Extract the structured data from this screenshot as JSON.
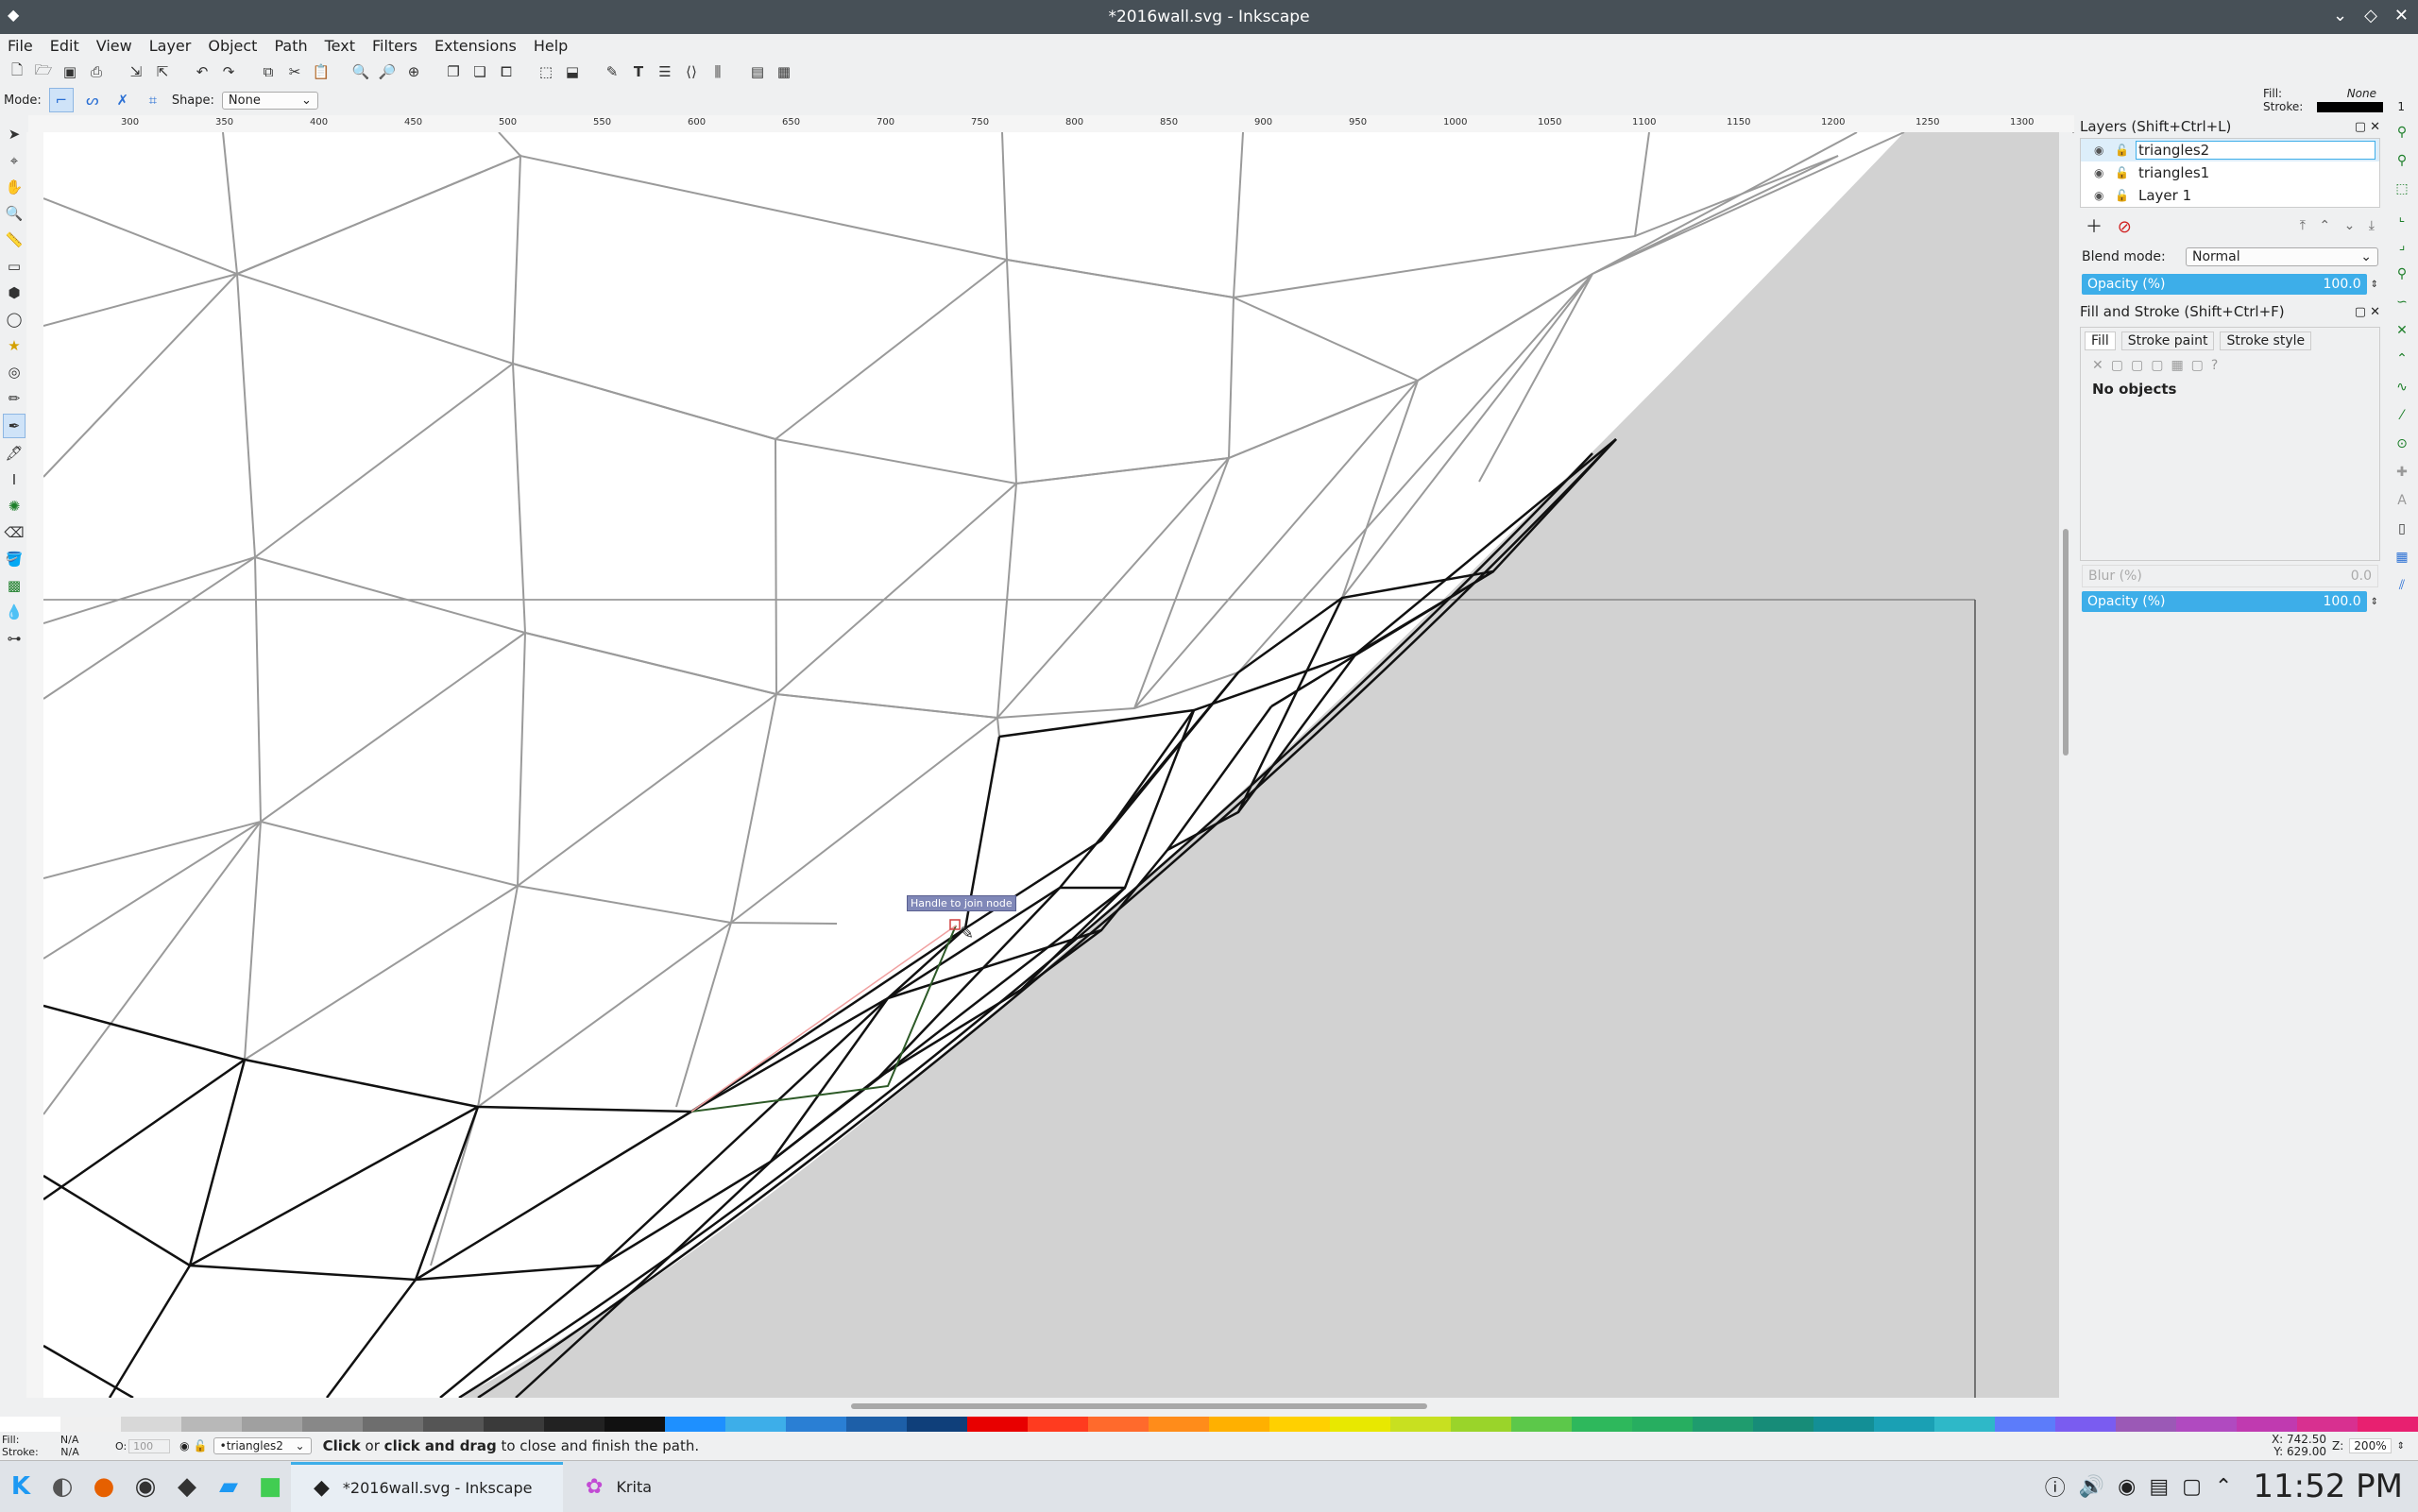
{
  "window": {
    "title": "*2016wall.svg - Inkscape",
    "controls": [
      "⌄",
      "◇",
      "✕"
    ]
  },
  "menu": [
    "File",
    "Edit",
    "View",
    "Layer",
    "Object",
    "Path",
    "Text",
    "Filters",
    "Extensions",
    "Help"
  ],
  "tool_controls": {
    "mode_label": "Mode:",
    "shape_label": "Shape:",
    "shape_value": "None"
  },
  "fill_stroke_indicator": {
    "fill_label": "Fill:",
    "fill_value": "None",
    "stroke_label": "Stroke:",
    "stroke_width": "1"
  },
  "ruler": {
    "ticks": [
      "300",
      "350",
      "400",
      "450",
      "500",
      "550",
      "600",
      "650",
      "700",
      "750",
      "800",
      "850",
      "900",
      "950",
      "1000",
      "1050",
      "1100",
      "1150",
      "1200",
      "1250",
      "1300"
    ]
  },
  "canvas": {
    "tooltip": "Handle to join node"
  },
  "layers": {
    "title": "Layers (Shift+Ctrl+L)",
    "items": [
      {
        "name": "triangles2",
        "selected": true
      },
      {
        "name": "triangles1",
        "selected": false
      },
      {
        "name": "Layer 1",
        "selected": false
      }
    ],
    "blend_label": "Blend mode:",
    "blend_value": "Normal",
    "opacity_label": "Opacity (%)",
    "opacity_value": "100.0"
  },
  "fill_stroke": {
    "title": "Fill and Stroke (Shift+Ctrl+F)",
    "tabs": [
      "Fill",
      "Stroke paint",
      "Stroke style"
    ],
    "message": "No objects",
    "blur_label": "Blur (%)",
    "blur_value": "0.0",
    "opacity_label": "Opacity (%)",
    "opacity_value": "100.0"
  },
  "palette": [
    "#ffffff",
    "#f0f0f0",
    "#d8d8d8",
    "#b8b8b8",
    "#a0a0a0",
    "#888888",
    "#6e6e6e",
    "#555555",
    "#3a3a3a",
    "#222222",
    "#111111",
    "#1e90ff",
    "#3daee9",
    "#2a7fd4",
    "#1d5fa8",
    "#0f3f7a",
    "#e80000",
    "#ff3b1f",
    "#ff6a2c",
    "#ff8c1a",
    "#ffb000",
    "#ffd000",
    "#e8e800",
    "#c8e020",
    "#9ad42a",
    "#5cc84a",
    "#2eb85c",
    "#27ae60",
    "#1f9c6e",
    "#178c78",
    "#138f96",
    "#1aa0b4",
    "#2eb8c8",
    "#5c7cfa",
    "#7a5cf0",
    "#9b59b6",
    "#b04ac0",
    "#c03ab0",
    "#d83090",
    "#e82070"
  ],
  "status": {
    "fill_label": "Fill:",
    "fill_value": "N/A",
    "stroke_label": "Stroke:",
    "stroke_value": "N/A",
    "opacity_label": "O:",
    "opacity_value": "100",
    "layer_value": "•triangles2",
    "message_prefix": "Click",
    "message_mid": " or ",
    "message_bold": "click and drag",
    "message_suffix": " to close and finish the path.",
    "x_label": "X:",
    "x_value": "742.50",
    "y_label": "Y:",
    "y_value": "629.00",
    "zoom_label": "Z:",
    "zoom_value": "200%"
  },
  "taskbar": {
    "tasks": [
      {
        "label": "*2016wall.svg - Inkscape",
        "active": true
      },
      {
        "label": "Krita",
        "active": false
      }
    ],
    "clock": "11:52 PM"
  }
}
